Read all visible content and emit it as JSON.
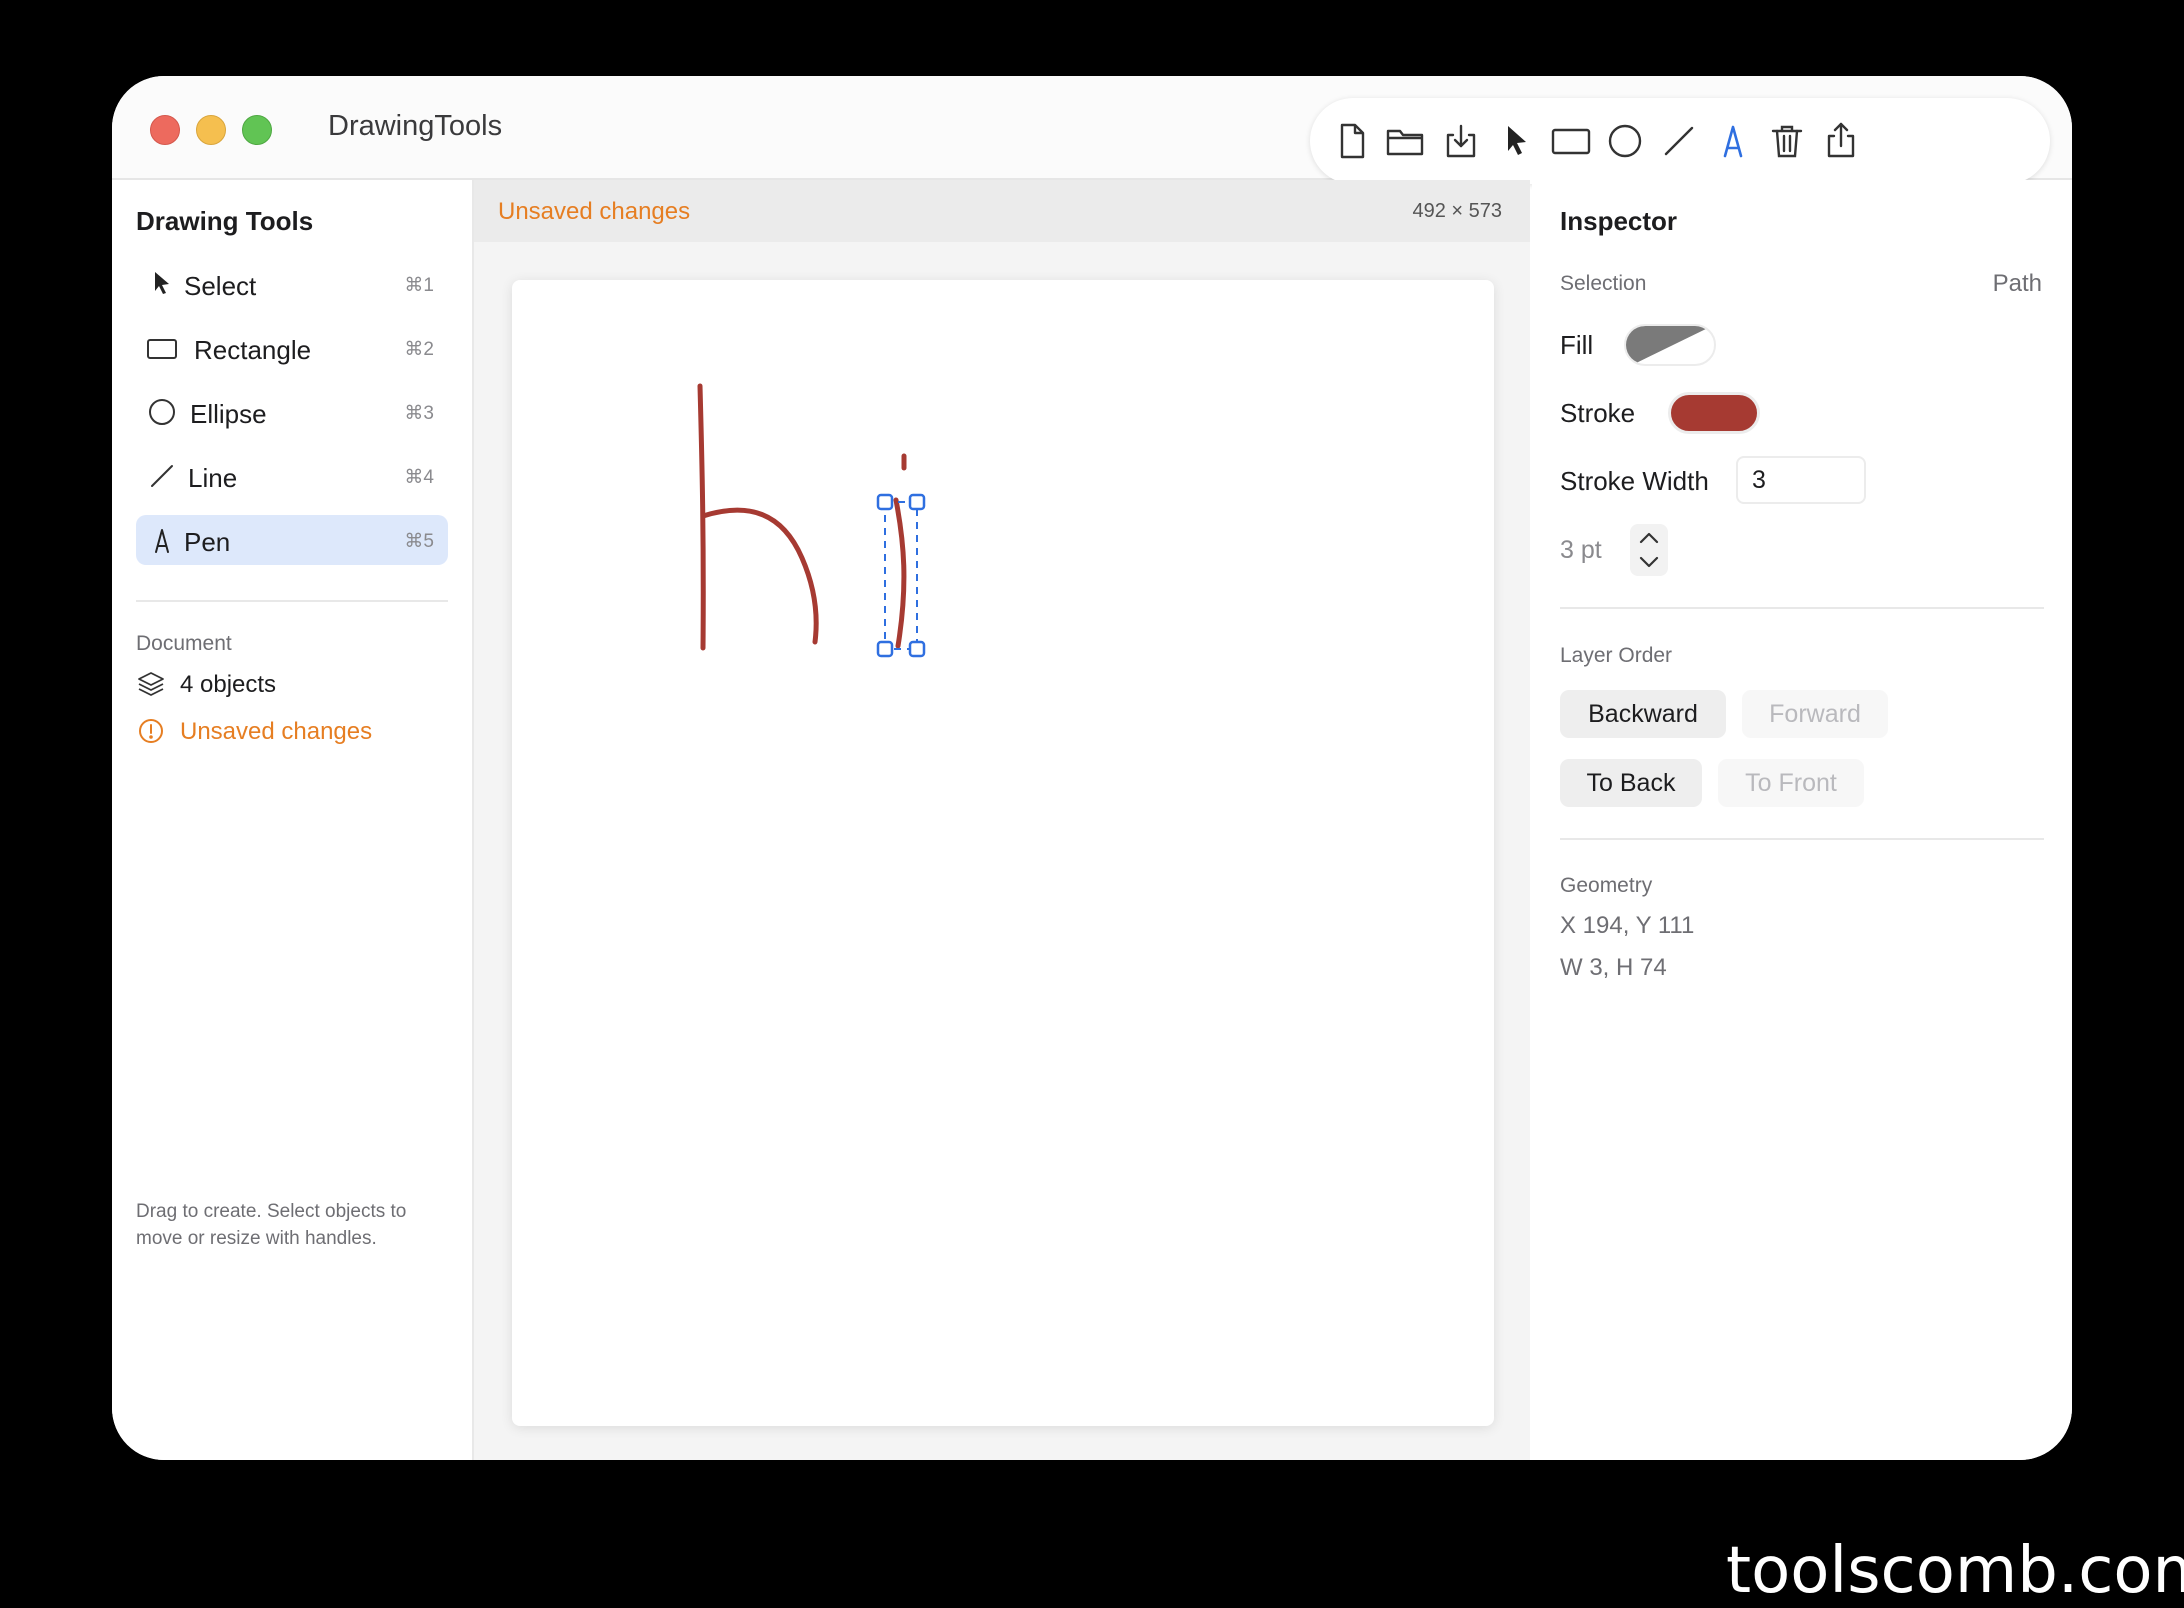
{
  "window": {
    "title": "DrawingTools",
    "traffic_lights": [
      "close",
      "minimize",
      "zoom"
    ]
  },
  "toolbar": {
    "buttons": [
      {
        "icon": "new-document-icon"
      },
      {
        "icon": "open-folder-icon"
      },
      {
        "icon": "save-download-icon"
      },
      {
        "icon": "select-arrow-icon"
      },
      {
        "icon": "rectangle-icon"
      },
      {
        "icon": "ellipse-icon"
      },
      {
        "icon": "line-icon"
      },
      {
        "icon": "pen-icon",
        "active": true
      },
      {
        "icon": "trash-icon"
      },
      {
        "icon": "share-icon"
      }
    ],
    "active_color": "#2f6fe0"
  },
  "sidebar": {
    "title": "Drawing Tools",
    "tools": [
      {
        "label": "Select",
        "shortcut": "⌘1",
        "icon": "select-arrow-icon"
      },
      {
        "label": "Rectangle",
        "shortcut": "⌘2",
        "icon": "rectangle-icon"
      },
      {
        "label": "Ellipse",
        "shortcut": "⌘3",
        "icon": "ellipse-icon"
      },
      {
        "label": "Line",
        "shortcut": "⌘4",
        "icon": "line-icon"
      },
      {
        "label": "Pen",
        "shortcut": "⌘5",
        "icon": "pen-icon",
        "active": true
      }
    ],
    "document_heading": "Document",
    "object_count": "4 objects",
    "unsaved": "Unsaved changes",
    "help_text": "Drag to create. Select objects to move or resize with handles."
  },
  "canvas_header": {
    "status": "Unsaved changes",
    "size": "492 × 573"
  },
  "inspector": {
    "title": "Inspector",
    "selection_label": "Selection",
    "selection_value": "Path",
    "fill_label": "Fill",
    "stroke_label": "Stroke",
    "stroke_color": "#a63a32",
    "stroke_width_label": "Stroke Width",
    "stroke_width_value": "3",
    "stroke_width_pt": "3 pt",
    "layer_order_label": "Layer Order",
    "backward": "Backward",
    "forward": "Forward",
    "to_back": "To Back",
    "to_front": "To Front",
    "geometry_label": "Geometry",
    "position": "X 194, Y 111",
    "size": "W 3, H 74"
  },
  "colors": {
    "accent_blue": "#2f6fe0",
    "warning_orange": "#e67e22",
    "stroke_red": "#a63a32"
  },
  "watermark": "toolscomb.com"
}
